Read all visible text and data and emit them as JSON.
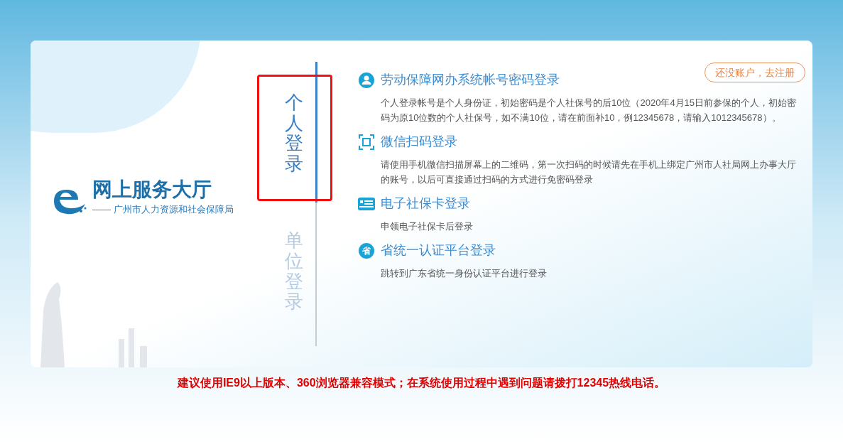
{
  "logo": {
    "title": "网上服务大厅",
    "subtitle": "—— 广州市人力资源和社会保障局"
  },
  "tabs": [
    {
      "label": "个人登录",
      "selected": true,
      "highlighted": true
    },
    {
      "label": "单位登录",
      "selected": false,
      "highlighted": false
    }
  ],
  "register_button": "还没账户，去注册",
  "login_methods": [
    {
      "kind": "user",
      "title": "劳动保障网办系统帐号密码登录",
      "description": "个人登录帐号是个人身份证，初始密码是个人社保号的后10位（2020年4月15日前参保的个人，初始密码为原10位数的个人社保号，如不满10位，请在前面补10，例12345678，请输入1012345678）。"
    },
    {
      "kind": "scan",
      "title": "微信扫码登录",
      "description": "请使用手机微信扫描屏幕上的二维码，第一次扫码的时候请先在手机上绑定广州市人社局网上办事大厅的账号，以后可直接通过扫码的方式进行免密码登录"
    },
    {
      "kind": "card",
      "title": "电子社保卡登录",
      "description": "申领电子社保卡后登录"
    },
    {
      "kind": "badge",
      "icon_text": "省",
      "title": "省统一认证平台登录",
      "description": "跳转到广东省统一身份认证平台进行登录"
    }
  ],
  "notice": "建议使用IE9以上版本、360浏览器兼容模式；在系统使用过程中遇到问题请拨打12345热线电话。"
}
